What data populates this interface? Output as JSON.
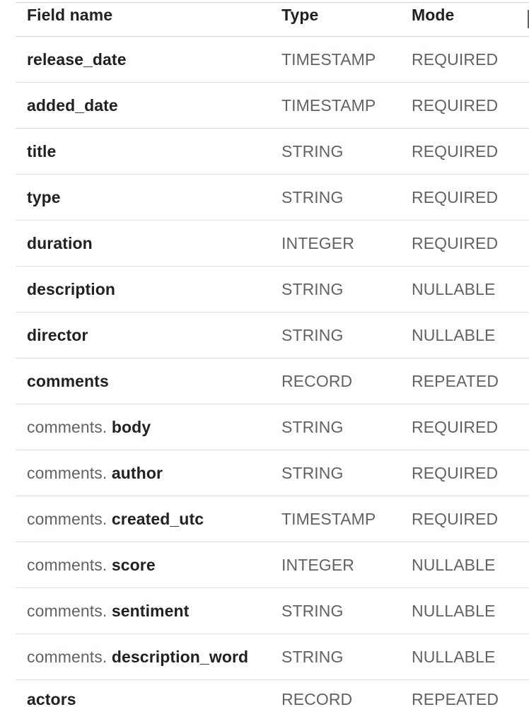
{
  "header": {
    "field_name": "Field name",
    "type": "Type",
    "mode": "Mode"
  },
  "rows": [
    {
      "parent": "",
      "name": "release_date",
      "type": "TIMESTAMP",
      "mode": "REQUIRED"
    },
    {
      "parent": "",
      "name": "added_date",
      "type": "TIMESTAMP",
      "mode": "REQUIRED"
    },
    {
      "parent": "",
      "name": "title",
      "type": "STRING",
      "mode": "REQUIRED"
    },
    {
      "parent": "",
      "name": "type",
      "type": "STRING",
      "mode": "REQUIRED"
    },
    {
      "parent": "",
      "name": "duration",
      "type": "INTEGER",
      "mode": "REQUIRED"
    },
    {
      "parent": "",
      "name": "description",
      "type": "STRING",
      "mode": "NULLABLE"
    },
    {
      "parent": "",
      "name": "director",
      "type": "STRING",
      "mode": "NULLABLE"
    },
    {
      "parent": "",
      "name": "comments",
      "type": "RECORD",
      "mode": "REPEATED"
    },
    {
      "parent": "comments.",
      "name": "body",
      "type": "STRING",
      "mode": "REQUIRED"
    },
    {
      "parent": "comments.",
      "name": "author",
      "type": "STRING",
      "mode": "REQUIRED"
    },
    {
      "parent": "comments.",
      "name": "created_utc",
      "type": "TIMESTAMP",
      "mode": "REQUIRED"
    },
    {
      "parent": "comments.",
      "name": "score",
      "type": "INTEGER",
      "mode": "NULLABLE"
    },
    {
      "parent": "comments.",
      "name": "sentiment",
      "type": "STRING",
      "mode": "NULLABLE"
    },
    {
      "parent": "comments.",
      "name": "description_word",
      "type": "STRING",
      "mode": "NULLABLE"
    },
    {
      "parent": "",
      "name": "actors",
      "type": "RECORD",
      "mode": "REPEATED"
    }
  ],
  "colors": {
    "primary_text": "#202124",
    "secondary_text": "#5f6368",
    "divider": "#e0e0e0"
  }
}
